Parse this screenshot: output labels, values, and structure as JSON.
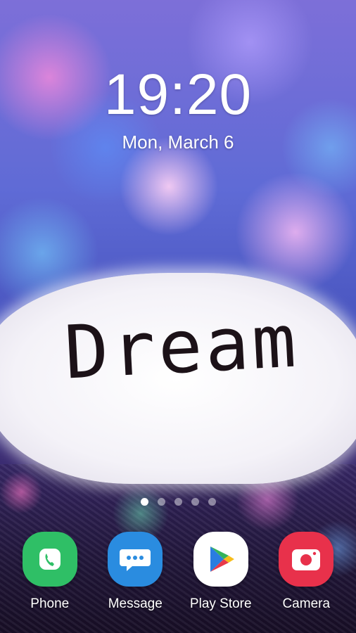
{
  "lockscreen": {
    "time": "19:20",
    "date": "Mon, March 6"
  },
  "wallpaper": {
    "word": "Dream"
  },
  "pager": {
    "page_count": 5,
    "active_index": 0
  },
  "dock": {
    "apps": [
      {
        "label": "Phone",
        "icon": "phone-icon",
        "color": "#2fbf66"
      },
      {
        "label": "Message",
        "icon": "message-icon",
        "color": "#2a8ce0"
      },
      {
        "label": "Play Store",
        "icon": "play-store-icon",
        "color": "#ffffff"
      },
      {
        "label": "Camera",
        "icon": "camera-icon",
        "color": "#e8314b"
      }
    ]
  }
}
